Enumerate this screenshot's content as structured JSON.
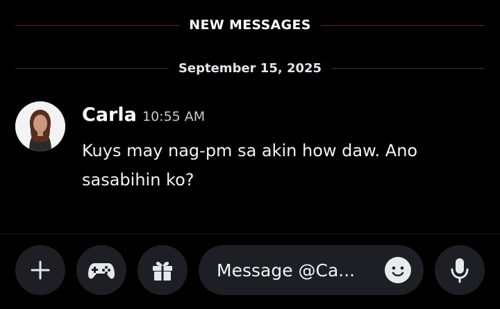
{
  "dividers": {
    "new_messages": "NEW MESSAGES",
    "date": "September 15, 2025"
  },
  "message": {
    "author": "Carla",
    "timestamp": "10:55 AM",
    "text": "Kuys may nag-pm sa akin how daw. Ano sasabihin ko?"
  },
  "composer": {
    "placeholder": "Message @Ca...",
    "buttons": [
      "plus-icon",
      "gamepad-icon",
      "gift-icon",
      "emoji-icon",
      "microphone-icon"
    ]
  },
  "colors": {
    "background": "#000000",
    "new_messages_line": "#6b2428",
    "button_bg": "#1e1f24"
  }
}
